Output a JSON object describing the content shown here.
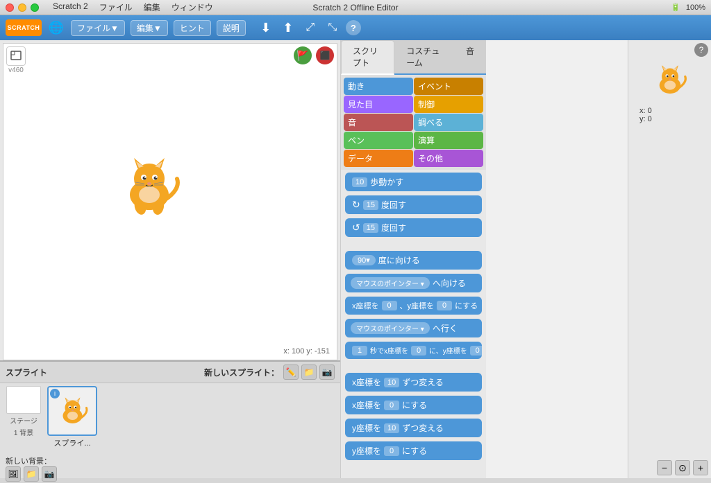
{
  "titlebar": {
    "app_name": "Scratch 2",
    "menu_items": [
      "ファイル",
      "編集",
      "ウィンドウ"
    ],
    "window_title": "Scratch 2 Offline Editor",
    "sys_info": "100%"
  },
  "toolbar": {
    "logo": "SCRATCH",
    "buttons": [
      {
        "label": "ファイル▼"
      },
      {
        "label": "編集▼"
      },
      {
        "label": "ヒント"
      },
      {
        "label": "説明"
      }
    ]
  },
  "tabs": {
    "items": [
      {
        "label": "スクリプト",
        "active": true
      },
      {
        "label": "コスチューム",
        "active": false
      },
      {
        "label": "音",
        "active": false
      }
    ]
  },
  "block_categories": [
    {
      "label": "動き",
      "color": "#4d97d8"
    },
    {
      "label": "イベント",
      "color": "#c88000"
    },
    {
      "label": "見た目",
      "color": "#9966ff"
    },
    {
      "label": "制御",
      "color": "#e6a000"
    },
    {
      "label": "音",
      "color": "#bb5555"
    },
    {
      "label": "調べる",
      "color": "#5cb1d6"
    },
    {
      "label": "ペン",
      "color": "#59c059"
    },
    {
      "label": "演算",
      "color": "#5cb645"
    },
    {
      "label": "データ",
      "color": "#ee7d16"
    },
    {
      "label": "その他",
      "color": "#a855d6"
    }
  ],
  "blocks": [
    {
      "text": "歩動かす",
      "prefix": "10",
      "color": "#4d97d8",
      "type": "move"
    },
    {
      "text": "度回す",
      "prefix": "15",
      "color": "#4d97d8",
      "type": "turn_cw"
    },
    {
      "text": "度回す",
      "prefix": "15",
      "color": "#4d97d8",
      "type": "turn_ccw"
    },
    {
      "text": "度に向ける",
      "prefix": "90▾",
      "color": "#4d97d8",
      "type": "point"
    },
    {
      "text": "へ向ける",
      "prefix": "マウスのポインター ▾",
      "color": "#4d97d8",
      "type": "point_towards"
    },
    {
      "text": "x座標を 0 、y座標を 0 にする",
      "color": "#4d97d8",
      "type": "goto_xy"
    },
    {
      "text": "へ行く",
      "prefix": "マウスのポインター ▾",
      "color": "#4d97d8",
      "type": "goto"
    },
    {
      "text": "秒でx座標を 0 に、y座標を 0",
      "prefix": "1",
      "color": "#4d97d8",
      "type": "glide"
    },
    {
      "text": "ずつ変える",
      "prefix_label": "x座標を",
      "value": "10",
      "color": "#4d97d8",
      "type": "change_x"
    },
    {
      "text": "にする",
      "prefix_label": "x座標を",
      "value": "0",
      "color": "#4d97d8",
      "type": "set_x"
    },
    {
      "text": "ずつ変える",
      "prefix_label": "y座標を",
      "value": "10",
      "color": "#4d97d8",
      "type": "change_y"
    },
    {
      "text": "にする",
      "prefix_label": "y座標を",
      "value": "0",
      "color": "#4d97d8",
      "type": "set_y"
    }
  ],
  "stage": {
    "coords": "x: 100  y: -151"
  },
  "sprite_panel": {
    "title": "スプライト",
    "new_sprite_label": "新しいスプライト：",
    "stage_label": "ステージ",
    "stage_bg": "1 背景",
    "new_backdrop_label": "新しい背景："
  },
  "sprite": {
    "name": "スプライ...",
    "coord_x": "x: 0",
    "coord_y": "y: 0"
  },
  "zoom": {
    "minus": "−",
    "reset": "⊙",
    "plus": "+"
  }
}
